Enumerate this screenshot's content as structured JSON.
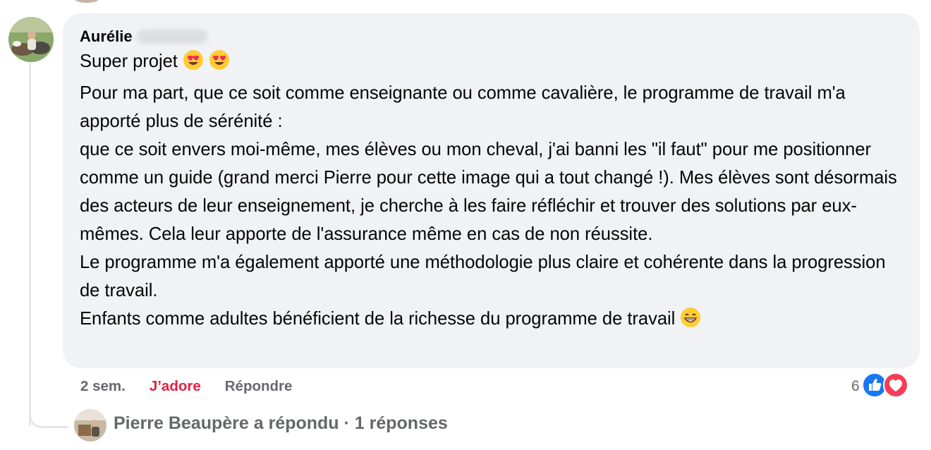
{
  "comment": {
    "author": "Aurélie",
    "paragraphs": [
      "Super projet",
      "Pour ma part, que ce soit comme enseignante ou comme cavalière, le programme de travail m'a apporté plus de sérénité :",
      "que ce soit envers moi-même, mes élèves ou mon cheval, j'ai banni les \"il faut\" pour me positionner comme un guide (grand merci Pierre pour cette image qui a tout changé !). Mes élèves sont désormais des acteurs de leur enseignement, je cherche à les faire réfléchir et trouver des solutions par eux-mêmes. Cela leur apporte de l'assurance même en cas de non réussite.",
      "Le programme m'a également apporté une méthodologie plus claire et cohérente dans la progression de travail.",
      "Enfants comme adultes bénéficient de la richesse du programme de travail"
    ],
    "emojis": [
      "heart-eyes-icon",
      "heart-eyes-icon",
      "grinning-icon"
    ]
  },
  "actions": {
    "time": "2 sem.",
    "reaction_label": "J’adore",
    "reply_label": "Répondre"
  },
  "reactions": {
    "count": "6",
    "icons": [
      "like-icon",
      "love-icon"
    ],
    "colors": {
      "like": "#1877f2",
      "love": "#f33e58"
    }
  },
  "replies": {
    "summary": "Pierre Beaupère a répondu · 1 réponses"
  },
  "colors": {
    "bubble_bg": "#f0f2f5",
    "secondary_text": "#65676b",
    "love_red": "#e41e3f"
  }
}
